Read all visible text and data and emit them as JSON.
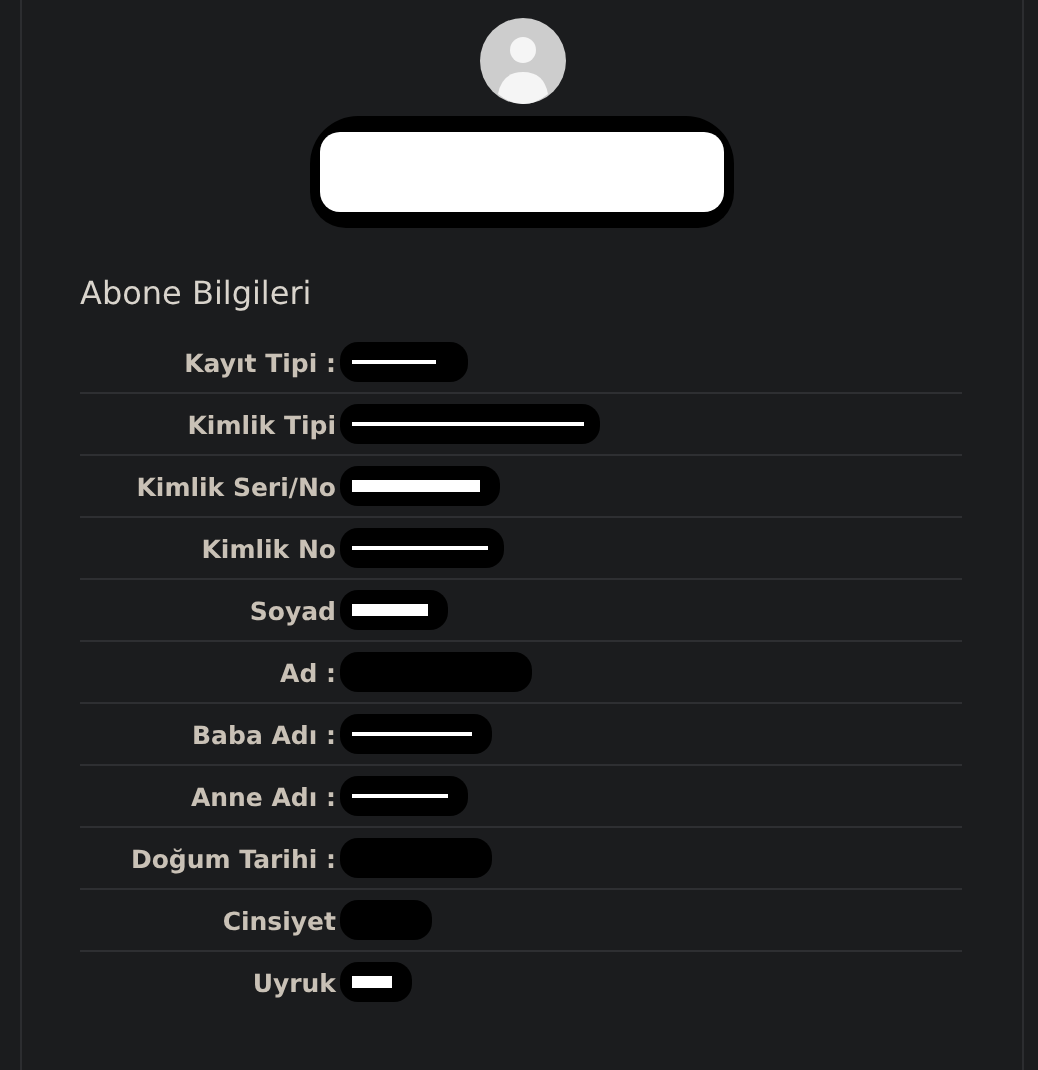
{
  "profile": {
    "name_redacted": true
  },
  "section": {
    "title": "Abone Bilgileri"
  },
  "fields": [
    {
      "label": "Kayıt Tipi :",
      "redacted": true
    },
    {
      "label": "Kimlik Tipi",
      "redacted": true
    },
    {
      "label": "Kimlik Seri/No",
      "redacted": true
    },
    {
      "label": "Kimlik No",
      "redacted": true
    },
    {
      "label": "Soyad",
      "redacted": true
    },
    {
      "label": "Ad :",
      "redacted": true
    },
    {
      "label": "Baba Adı :",
      "redacted": true
    },
    {
      "label": "Anne Adı :",
      "redacted": true
    },
    {
      "label": "Doğum Tarihi :",
      "redacted": true
    },
    {
      "label": "Cinsiyet",
      "redacted": true
    },
    {
      "label": "Uyruk",
      "redacted": true
    }
  ]
}
